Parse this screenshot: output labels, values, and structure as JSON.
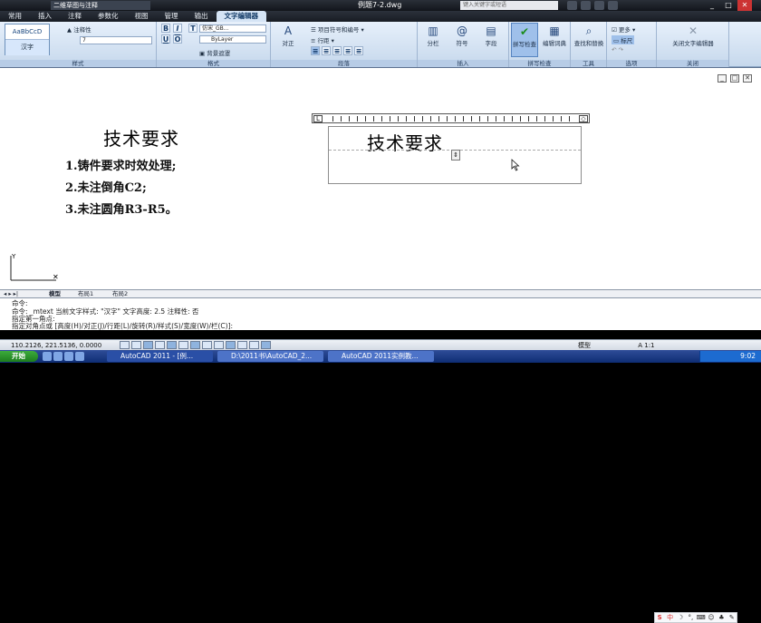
{
  "titlebar": {
    "workspace": "二维草图与注释",
    "file": "例题7-2.dwg",
    "search_placeholder": "键入关键字或短语"
  },
  "tabs": [
    "常用",
    "插入",
    "注释",
    "参数化",
    "视图",
    "管理",
    "输出",
    "文字编辑器"
  ],
  "ribbon": {
    "style_panel": {
      "preview_top": "AaBbCcD",
      "preview_bottom": "汉字",
      "annotative": "注释性",
      "height": "7",
      "label": "样式"
    },
    "format_panel": {
      "font": "仿宋_GB...",
      "color": "ByLayer",
      "background": "背景遮罩",
      "label": "格式"
    },
    "paragraph_panel": {
      "justify": "对正",
      "bullets": "项目符号和编号",
      "line_spacing": "行距",
      "label": "段落"
    },
    "insert_panel": {
      "columns": "分栏",
      "symbol": "符号",
      "field": "字段",
      "label": "插入"
    },
    "spell_panel": {
      "spellcheck": "拼写检查",
      "dictionary": "编辑词典",
      "label": "拼写检查"
    },
    "tools_panel": {
      "find_replace": "查找和替换",
      "label": "工具"
    },
    "options_panel": {
      "more": "更多",
      "ruler": "标尺",
      "label": "选项"
    },
    "close_panel": {
      "close": "关闭文字编辑器",
      "label": "关闭"
    }
  },
  "drawing": {
    "title": "技术要求",
    "items": [
      "1.铸件要求时效处理;",
      "2.未注倒角C2;",
      "3.未注圆角R3-R5。"
    ],
    "editor_text": "技术要求"
  },
  "layout_tabs": [
    "模型",
    "布局1",
    "布局2"
  ],
  "command": {
    "line1": "命令:",
    "line2": "命令: _mtext 当前文字样式: \"汉字\" 文字高度: 2.5 注释性: 否",
    "line3": "指定第一角点:",
    "line4": "指定对角点或 [高度(H)/对正(J)/行距(L)/旋转(R)/样式(S)/宽度(W)/栏(C)]:"
  },
  "status": {
    "coordinates": "110.2126, 221.5136, 0.0000",
    "model": "模型",
    "scale": "A 1:1"
  },
  "taskbar": {
    "start": "开始",
    "task1": "AutoCAD 2011 - [例...",
    "task2": "D:\\2011书\\AutoCAD_2...",
    "task3": "AutoCAD 2011实例教...",
    "time": "9:02"
  }
}
